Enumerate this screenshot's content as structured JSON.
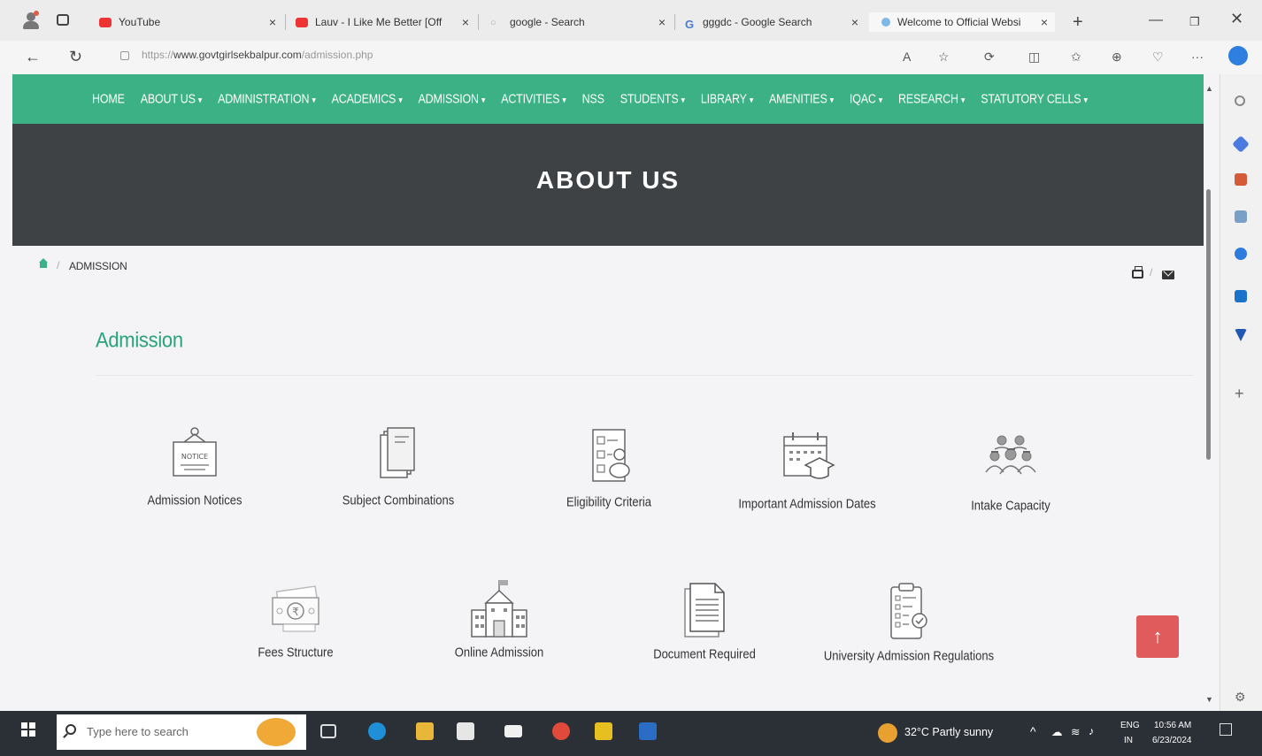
{
  "browser": {
    "tabs": [
      {
        "title": "YouTube",
        "favicon": "youtube-icon"
      },
      {
        "title": "Lauv - I Like Me Better [Off",
        "favicon": "youtube-icon"
      },
      {
        "title": "google - Search",
        "favicon": "search-icon"
      },
      {
        "title": "gggdc - Google Search",
        "favicon": "google-icon"
      },
      {
        "title": "Welcome to Official Websi",
        "favicon": "site-icon",
        "active": true
      }
    ],
    "url_prefix": "https://",
    "url_domain": "www.govtgirlsekbalpur.com",
    "url_path": "/admission.php"
  },
  "site": {
    "accent": "#3bb185",
    "nav": [
      "HOME",
      "ABOUT US",
      "ADMINISTRATION",
      "ACADEMICS",
      "ADMISSION",
      "ACTIVITIES",
      "NSS",
      "STUDENTS",
      "LIBRARY",
      "AMENITIES",
      "IQAC",
      "RESEARCH",
      "STATUTORY CELLS"
    ],
    "nav_caret": "▾",
    "hero_title": "ABOUT US",
    "breadcrumb": "ADMISSION",
    "breadcrumb_sep": "/",
    "page_title": "Admission",
    "items": [
      {
        "label": "Admission Notices",
        "icon": "notice-board-icon"
      },
      {
        "label": "Subject Combinations",
        "icon": "books-icon"
      },
      {
        "label": "Eligibility Criteria",
        "icon": "checklist-icon"
      },
      {
        "label": "Important Admission Dates",
        "icon": "calendar-graduation-icon"
      },
      {
        "label": "Intake Capacity",
        "icon": "students-group-icon"
      },
      {
        "label": "Fees Structure",
        "icon": "money-icon"
      },
      {
        "label": "Online Admission",
        "icon": "college-building-icon"
      },
      {
        "label": "Document Required",
        "icon": "document-icon"
      },
      {
        "label": "University Admission Regulations",
        "icon": "clipboard-check-icon"
      }
    ],
    "to_top": "↑"
  },
  "taskbar": {
    "search_placeholder": "Type here to search",
    "weather": "32°C  Partly sunny",
    "lang1": "ENG",
    "lang2": "IN",
    "time": "10:56 AM",
    "date": "6/23/2024"
  }
}
